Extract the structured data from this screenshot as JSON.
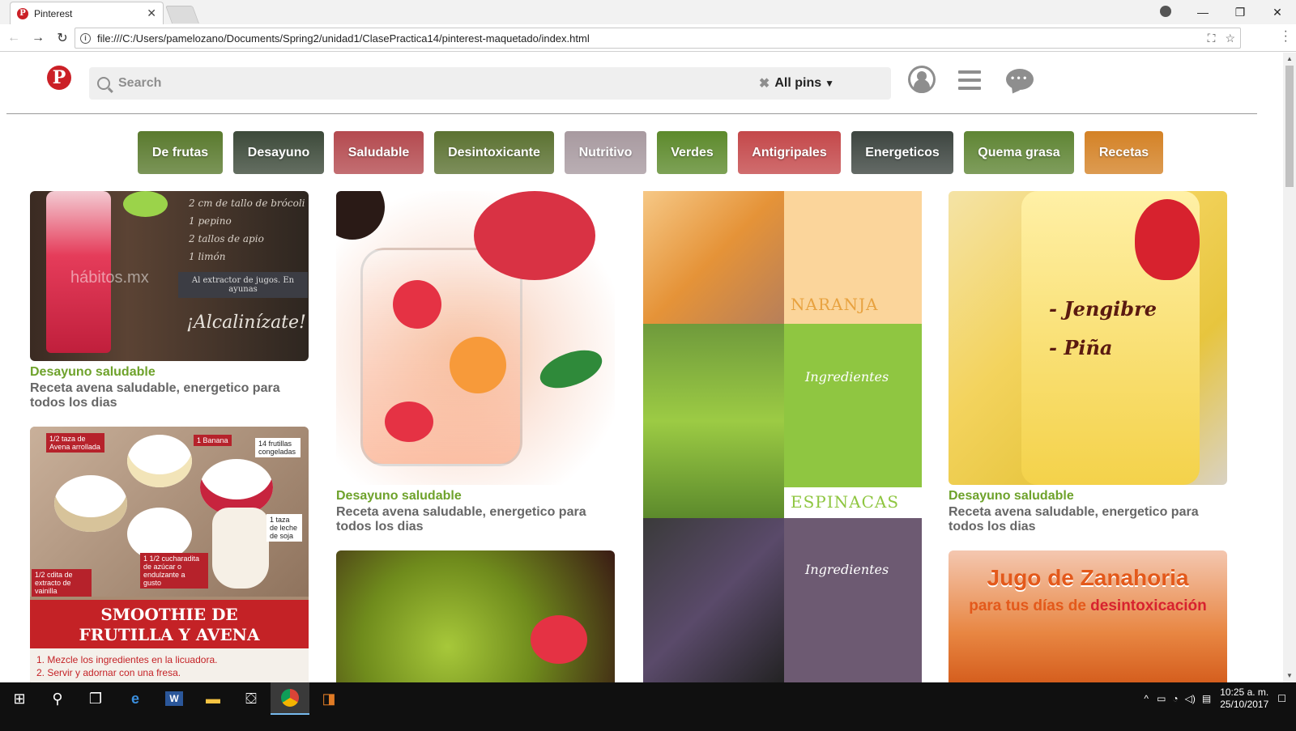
{
  "browser": {
    "tab_title": "Pinterest",
    "tab_close": "✕",
    "url": "file:///C:/Users/pamelozano/Documents/Spring2/unidad1/ClasePractica14/pinterest-maquetado/index.html",
    "icons": [
      "back-icon",
      "forward-icon",
      "reload-icon",
      "info-icon",
      "translate-icon",
      "star-icon",
      "menu-dots-icon"
    ]
  },
  "header": {
    "logo_letter": "P",
    "search_placeholder": "Search",
    "clear_glyph": "✖",
    "filter_label": "All pins",
    "filter_chevron": "⌄"
  },
  "categories": [
    {
      "label": "De frutas",
      "color": "#5a7a2e"
    },
    {
      "label": "Desayuno",
      "color": "#3d4a3a"
    },
    {
      "label": "Saludable",
      "color": "#b44a4f"
    },
    {
      "label": "Desintoxicante",
      "color": "#5c7232"
    },
    {
      "label": "Nutritivo",
      "color": "#a89aa0"
    },
    {
      "label": "Verdes",
      "color": "#5d8a2c"
    },
    {
      "label": "Antigripales",
      "color": "#c4484a"
    },
    {
      "label": "Energeticos",
      "color": "#3d4540"
    },
    {
      "label": "Quema grasa",
      "color": "#5f8534"
    },
    {
      "label": "Recetas",
      "color": "#d48226"
    }
  ],
  "pins": {
    "title": "Desayuno saludable",
    "desc": "Receta avena saludable, energetico para todos los dias",
    "p1_lines": [
      "2 cm de tallo de brócoli",
      "1 pepino",
      "2 tallos de apio",
      "1 limón"
    ],
    "p1_brand": "hábitos.mx",
    "p1_box": "Al extractor de jugos. En ayunas",
    "p1_big": "¡Alcalinízate!",
    "p5_labels": [
      "1/2 taza de Avena arrollada",
      "1 Banana",
      "14 frutillas congeladas",
      "1 taza de leche de soja",
      "1 1/2 cucharadita de azúcar o endulzante a gusto",
      "1/2 cdita de extracto de vainilla"
    ],
    "p5_heading": "SMOOTHIE DE FRUTILLA Y AVENA",
    "p5_steps": [
      "1. Mezcle los ingredientes en la licuadora.",
      "2. Servir y adornar con una fresa."
    ],
    "p3_labels": [
      "NARANJA",
      "Ingredientes",
      "ESPINACAS",
      "Ingredientes"
    ],
    "p4_words": [
      "- Jengibre",
      "- Piña"
    ],
    "p8_heading": "Jugo de Zanahoria",
    "p8_sub": "para tus días de ",
    "p8_sub_red": "desintoxicación"
  },
  "taskbar": {
    "time": "10:25 a. m.",
    "date": "25/10/2017"
  }
}
